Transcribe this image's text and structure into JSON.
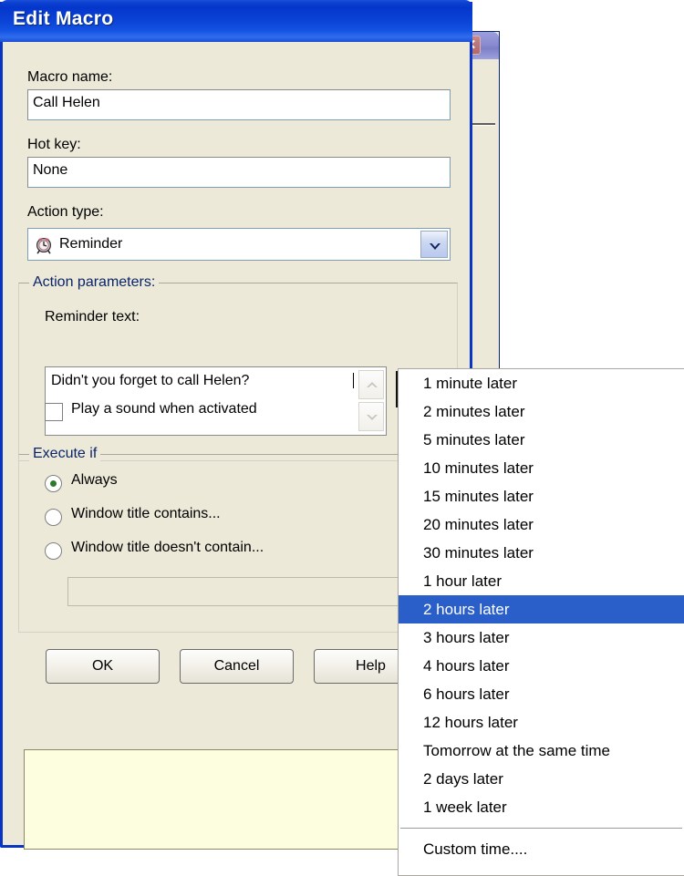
{
  "background_window": {
    "close_button_label": "✕",
    "close_icon": "close-icon"
  },
  "dialog": {
    "title": "Edit Macro",
    "fields": {
      "macro_name_label": "Macro name:",
      "macro_name_value": "Call Helen",
      "hot_key_label": "Hot key:",
      "hot_key_value": "None",
      "action_type_label": "Action type:",
      "action_type_value": "Reminder",
      "action_type_icon": "alarm-clock-icon",
      "dropdown_arrow_icon": "chevron-down-icon"
    },
    "action_parameters": {
      "legend": "Action parameters:",
      "reminder_text_label": "Reminder text:",
      "reminder_text_value": "Didn't you forget to call Helen?",
      "spinner_up_icon": "chevron-up-icon",
      "spinner_down_icon": "chevron-down-icon",
      "clock_button_icon": "alarm-clock-icon",
      "play_sound_label": "Play a sound when activated",
      "play_sound_checked": false
    },
    "execute_if": {
      "legend": "Execute if",
      "options": [
        {
          "label": "Always",
          "selected": true
        },
        {
          "label": "Window title contains...",
          "selected": false
        },
        {
          "label": "Window title doesn't contain...",
          "selected": false
        }
      ],
      "title_filter_value": ""
    },
    "buttons": {
      "ok": "OK",
      "cancel": "Cancel",
      "help": "Help"
    }
  },
  "popup_menu": {
    "items": [
      {
        "label": "1 minute later",
        "selected": false,
        "separator_before": false
      },
      {
        "label": "2 minutes later",
        "selected": false,
        "separator_before": false
      },
      {
        "label": "5 minutes later",
        "selected": false,
        "separator_before": false
      },
      {
        "label": "10 minutes later",
        "selected": false,
        "separator_before": false
      },
      {
        "label": "15 minutes later",
        "selected": false,
        "separator_before": false
      },
      {
        "label": "20 minutes later",
        "selected": false,
        "separator_before": false
      },
      {
        "label": "30 minutes later",
        "selected": false,
        "separator_before": false
      },
      {
        "label": "1 hour later",
        "selected": false,
        "separator_before": false
      },
      {
        "label": "2 hours later",
        "selected": true,
        "separator_before": false
      },
      {
        "label": "3 hours later",
        "selected": false,
        "separator_before": false
      },
      {
        "label": "4 hours later",
        "selected": false,
        "separator_before": false
      },
      {
        "label": "6 hours later",
        "selected": false,
        "separator_before": false
      },
      {
        "label": "12 hours later",
        "selected": false,
        "separator_before": false
      },
      {
        "label": "Tomorrow at the same time",
        "selected": false,
        "separator_before": false
      },
      {
        "label": "2 days later",
        "selected": false,
        "separator_before": false
      },
      {
        "label": "1 week later",
        "selected": false,
        "separator_before": false
      },
      {
        "label": "Custom time....",
        "selected": false,
        "separator_before": true
      }
    ]
  },
  "colors": {
    "title_bar_blue": "#0a3fd0",
    "dialog_face": "#ece9d8",
    "menu_highlight": "#2a5fc9",
    "group_legend_blue": "#0a246a",
    "info_panel_yellow": "#fdfddf",
    "radio_dot_green": "#2c7a2c"
  }
}
